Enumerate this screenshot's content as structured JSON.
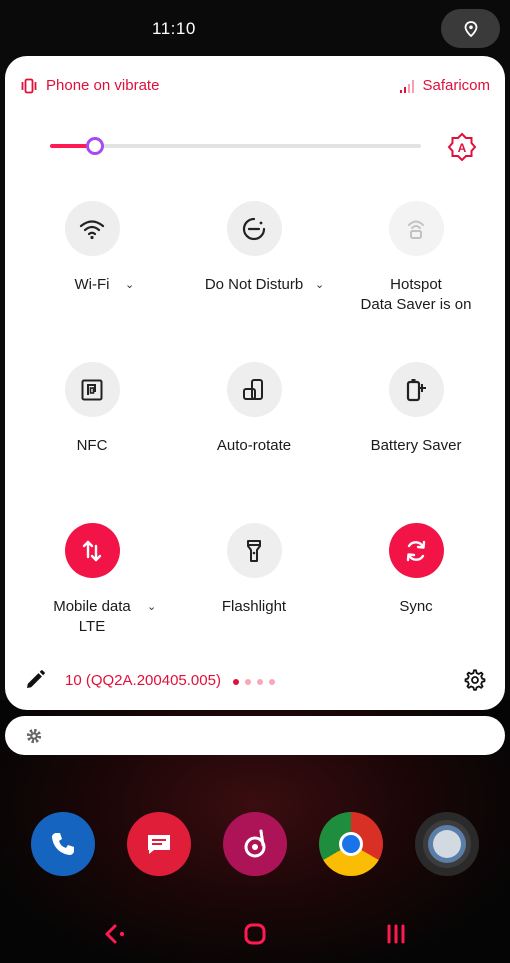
{
  "status_bar": {
    "time": "11:10",
    "location_icon": "location-pin-icon"
  },
  "header": {
    "ringer_mode": "Phone on vibrate",
    "carrier": "Safaricom"
  },
  "brightness": {
    "level_fraction": 0.12,
    "auto_icon": "auto-brightness-icon"
  },
  "tiles": [
    {
      "id": "wifi",
      "label": "Wi-Fi",
      "sub": "",
      "icon": "wifi-icon",
      "state": "off",
      "expandable": true
    },
    {
      "id": "dnd",
      "label": "Do Not Disturb",
      "sub": "",
      "icon": "do-not-disturb-icon",
      "state": "off",
      "expandable": true
    },
    {
      "id": "hotspot",
      "label": "Hotspot",
      "sub": "Data Saver is on",
      "icon": "hotspot-icon",
      "state": "unavailable",
      "expandable": false
    },
    {
      "id": "nfc",
      "label": "NFC",
      "sub": "",
      "icon": "nfc-icon",
      "state": "off",
      "expandable": false
    },
    {
      "id": "autorotate",
      "label": "Auto-rotate",
      "sub": "",
      "icon": "auto-rotate-icon",
      "state": "off",
      "expandable": false
    },
    {
      "id": "battery",
      "label": "Battery Saver",
      "sub": "",
      "icon": "battery-saver-icon",
      "state": "off",
      "expandable": false
    },
    {
      "id": "mobiledata",
      "label": "Mobile data",
      "sub": "LTE",
      "icon": "mobile-data-icon",
      "state": "on",
      "expandable": true
    },
    {
      "id": "flashlight",
      "label": "Flashlight",
      "sub": "",
      "icon": "flashlight-icon",
      "state": "off",
      "expandable": false
    },
    {
      "id": "sync",
      "label": "Sync",
      "sub": "",
      "icon": "sync-icon",
      "state": "on",
      "expandable": false
    }
  ],
  "footer": {
    "build": "10 (QQ2A.200405.005)",
    "page_count": 4,
    "active_page": 1
  },
  "colors": {
    "accent": "#e0103a",
    "tile_on": "#f31447",
    "tile_off": "#eeeeee",
    "slider_thumb": "#a64bf4"
  },
  "dock_apps": [
    "phone-icon",
    "messages-icon",
    "music-icon",
    "chrome-icon",
    "camera-icon"
  ],
  "nav": [
    "back-icon",
    "home-icon",
    "recents-icon"
  ]
}
